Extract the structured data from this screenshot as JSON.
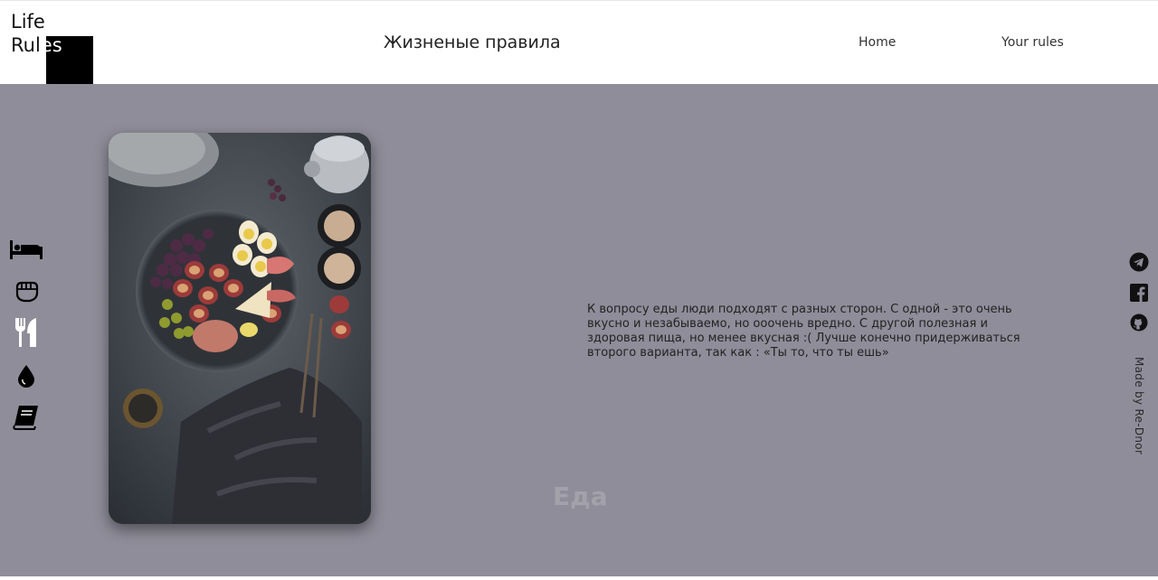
{
  "header": {
    "logo_line1": "Life",
    "logo_line2_a": "Rul",
    "logo_line2_b": "es",
    "title": "Жизненые правила",
    "nav": {
      "home": "Home",
      "rules": "Your rules"
    }
  },
  "sidebar": {
    "icons": [
      "bed-icon",
      "fist-icon",
      "fork-knife-icon",
      "water-drop-icon",
      "book-icon"
    ]
  },
  "main": {
    "description": "К вопросу еды люди подходят с разных сторон. С одной - это очень вкусно и незабываемо, но ооочень вредно. С другой полезная и здоровая пища, но менее вкусная :( Лучше конечно придерживаться второго варианта, так как : «Ты то, что ты ешь»",
    "section_title": "Еда"
  },
  "social": {
    "icons": [
      "telegram-icon",
      "facebook-icon",
      "github-icon"
    ],
    "made_by": "Made by Re-Dnor"
  },
  "colors": {
    "main_bg": "#8f8d99",
    "header_bg": "#ffffff",
    "title_faded": "#a3a1aa"
  }
}
